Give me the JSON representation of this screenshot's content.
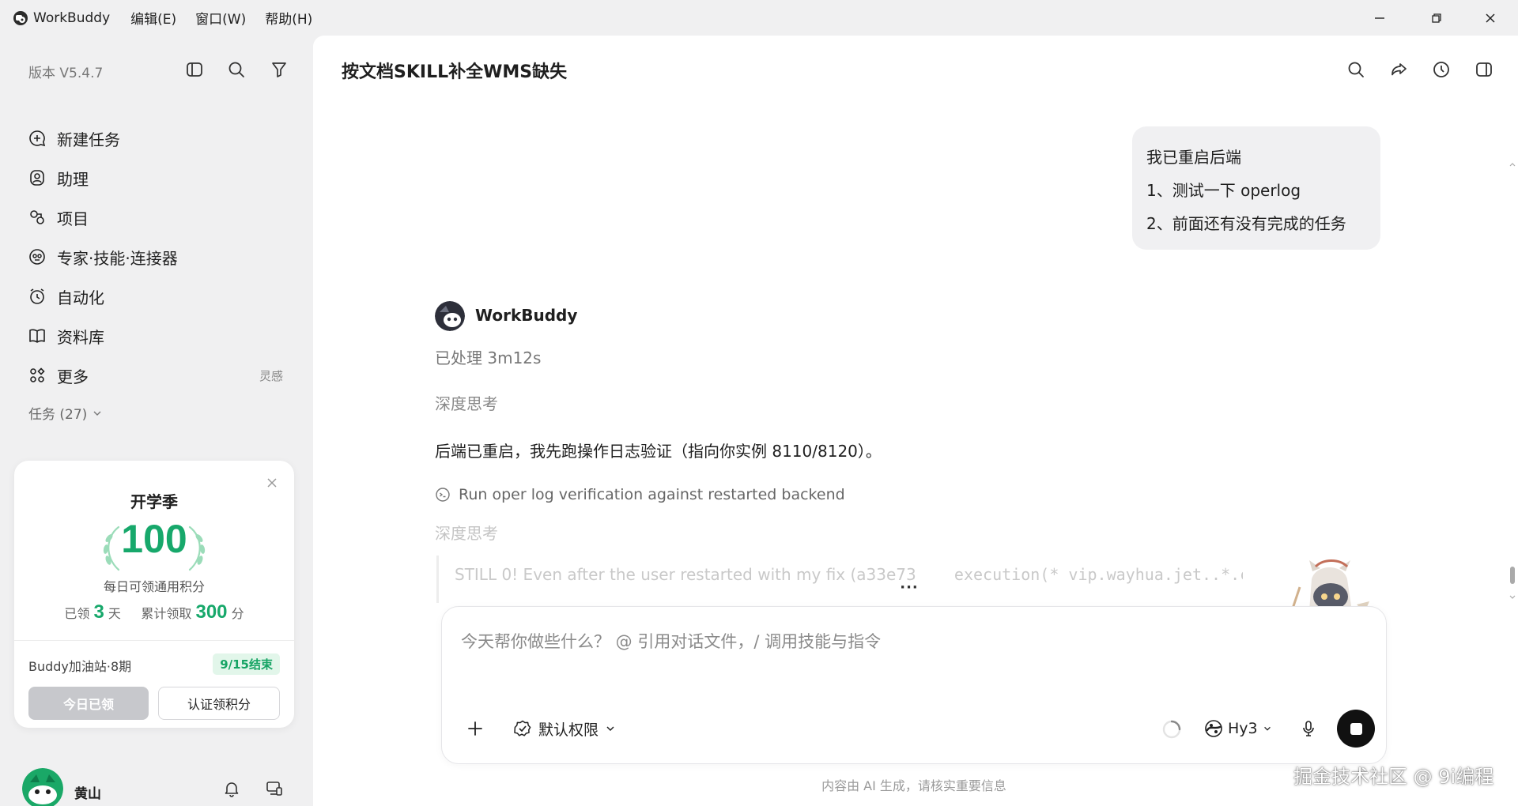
{
  "menubar": {
    "app_name": "WorkBuddy",
    "items": [
      "编辑(E)",
      "窗口(W)",
      "帮助(H)"
    ]
  },
  "sidebar": {
    "version": "版本 V5.4.7",
    "nav": [
      {
        "label": "新建任务",
        "icon": "plus-chat-icon"
      },
      {
        "label": "助理",
        "icon": "assistant-icon"
      },
      {
        "label": "项目",
        "icon": "project-icon"
      },
      {
        "label": "专家·技能·连接器",
        "icon": "expert-icon"
      },
      {
        "label": "自动化",
        "icon": "alarm-icon"
      },
      {
        "label": "资料库",
        "icon": "book-icon"
      },
      {
        "label": "更多",
        "icon": "grid-icon"
      }
    ],
    "more_hint": "灵感",
    "tasks_header": "任务 (27)"
  },
  "promo": {
    "title": "开学季",
    "number": "100",
    "subtitle": "每日可领通用积分",
    "stat_prefix": "已领",
    "stat_days": "3",
    "stat_days_unit": "天",
    "stat_total_prefix": "累计领取",
    "stat_total": "300",
    "stat_total_unit": "分",
    "station": "Buddy加油站·8期",
    "badge": "9/15结束",
    "btn_claimed": "今日已领",
    "btn_verify": "认证领积分"
  },
  "user": {
    "name": "黄山"
  },
  "conversation": {
    "title": "按文档SKILL补全WMS缺失",
    "user_message": [
      "我已重启后端",
      "1、测试一下 operlog",
      "2、前面还有没有完成的任务"
    ],
    "bot_name": "WorkBuddy",
    "processed": "已处理 3m12s",
    "thinking_label_1": "深度思考",
    "reply": "后端已重启，我先跑操作日志验证（指向你实例 8110/8120）。",
    "tool_run": "Run oper log verification against restarted backend",
    "thinking_label_2": "深度思考",
    "thinking_stream_text": "STILL 0! Even after the user restarted with my fix (a33e73",
    "thinking_stream_code": "execution(* vip.wayhua.jet..*.contro",
    "dots": "···"
  },
  "composer": {
    "placeholder": "今天帮你做些什么？ @ 引用对话文件，/ 调用技能与指令",
    "permission": "默认权限",
    "model": "Hy3"
  },
  "footer": {
    "disclaimer": "内容由 AI 生成，请核实重要信息",
    "watermark": "掘金技术社区 @ 9i编程"
  },
  "colors": {
    "accent_green": "#17a86b",
    "sidebar_bg": "#f0f0f1",
    "main_bg": "#ffffff"
  }
}
